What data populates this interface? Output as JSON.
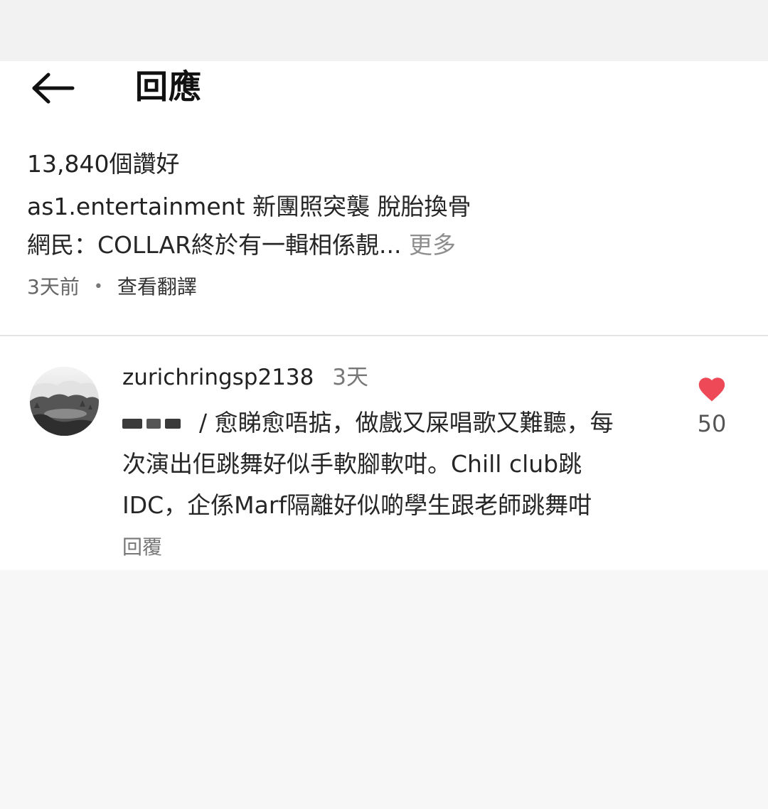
{
  "header": {
    "title": "回應",
    "back_icon": "arrow-left-icon"
  },
  "post": {
    "likes": "13,840個讚好",
    "username": "as1.entertainment",
    "caption_line1": "新團照突襲 脫胎換骨",
    "caption_line2": "網民：COLLAR終於有一輯相係靚...",
    "more_label": "更多",
    "time": "3天前",
    "separator": "•",
    "translate_label": "查看翻譯"
  },
  "comment": {
    "username": "zurichringsp2138",
    "time": "3天",
    "text_line1": "/ 愈睇愈唔掂，做戲又屎唱歌又難聽，每",
    "text_line2": "次演出佢跳舞好似手軟腳軟咁。Chill club跳",
    "text_line3": "IDC，企係Marf隔離好似啲學生跟老師跳舞咁",
    "reply_label": "回覆",
    "like_count": "50",
    "heart_icon": "heart-filled-icon",
    "heart_color": "#ed4956",
    "avatar_icon": "landscape-avatar"
  }
}
